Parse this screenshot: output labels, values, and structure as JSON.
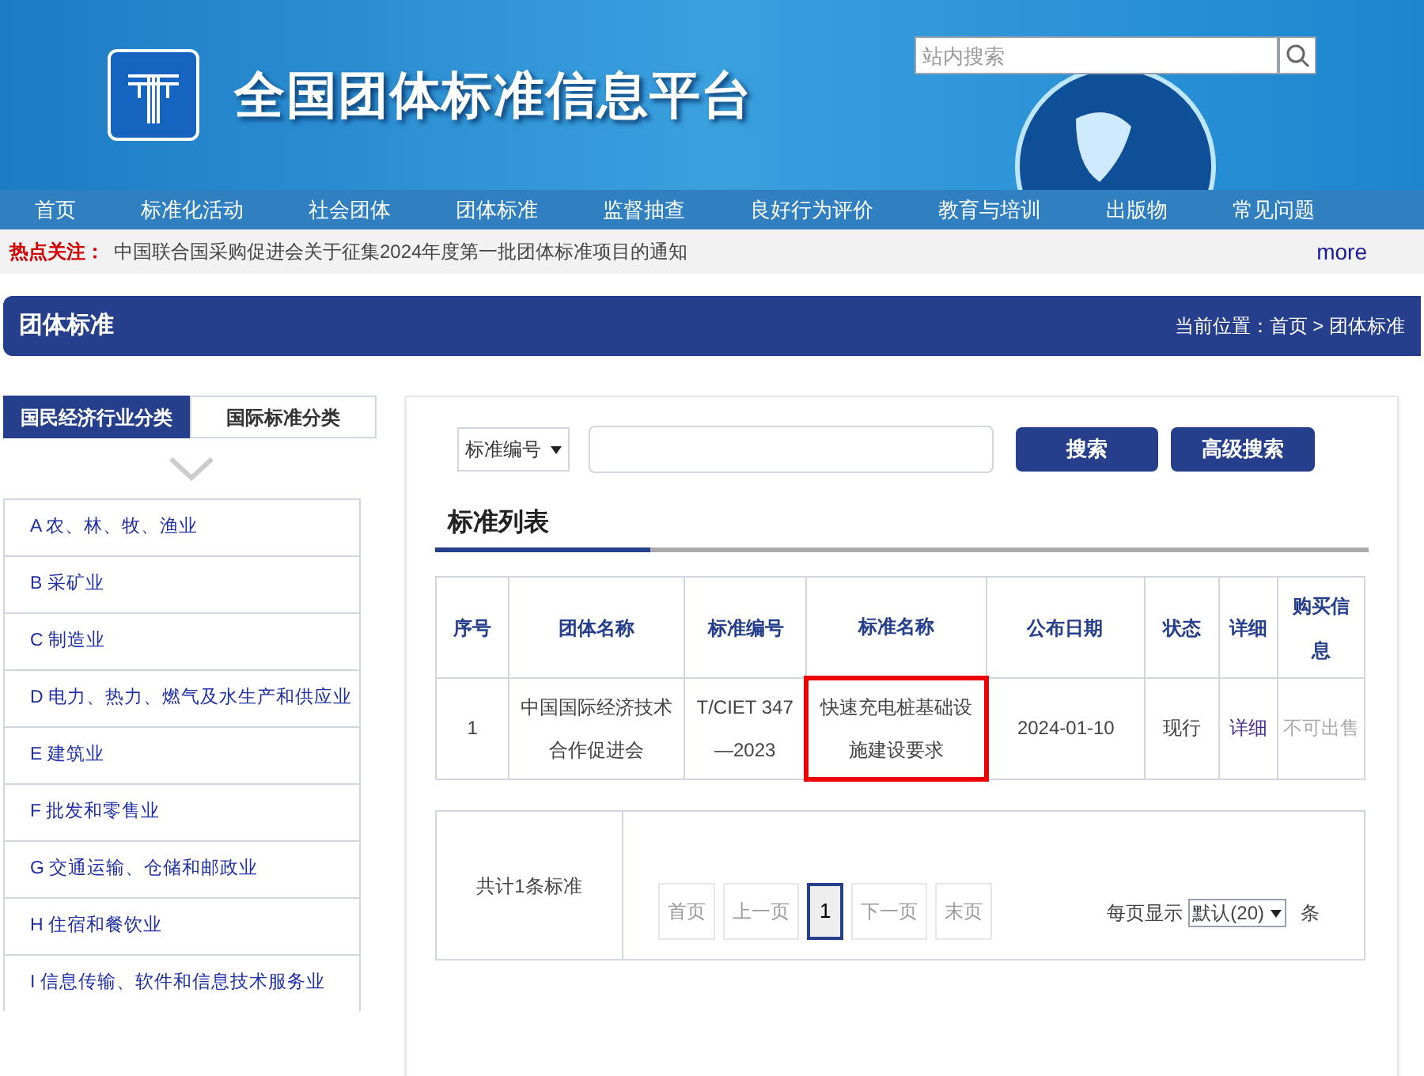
{
  "header": {
    "site_title": "全国团体标准信息平台",
    "search": {
      "placeholder": "站内搜索"
    }
  },
  "nav": [
    {
      "label": "首页"
    },
    {
      "label": "标准化活动"
    },
    {
      "label": "社会团体"
    },
    {
      "label": "团体标准"
    },
    {
      "label": "监督抽查"
    },
    {
      "label": "良好行为评价"
    },
    {
      "label": "教育与培训"
    },
    {
      "label": "出版物"
    },
    {
      "label": "常见问题"
    }
  ],
  "hot_news": {
    "label": "热点关注：",
    "text": "中国联合国采购促进会关于征集2024年度第一批团体标准项目的通知",
    "more": "more"
  },
  "page_title": {
    "title": "团体标准",
    "breadcrumb": "当前位置：首页 > 团体标准"
  },
  "sidebar": {
    "tabs": [
      {
        "label": "国民经济行业分类",
        "selected": true
      },
      {
        "label": "国际标准分类",
        "selected": false
      }
    ],
    "items": [
      {
        "label": "A 农、林、牧、渔业"
      },
      {
        "label": "B 采矿业"
      },
      {
        "label": "C 制造业"
      },
      {
        "label": "D 电力、热力、燃气及水生产和供应业"
      },
      {
        "label": "E 建筑业"
      },
      {
        "label": "F 批发和零售业"
      },
      {
        "label": "G 交通运输、仓储和邮政业"
      },
      {
        "label": "H 住宿和餐饮业"
      },
      {
        "label": "I 信息传输、软件和信息技术服务业"
      }
    ]
  },
  "search_bar": {
    "field_select": "标准编号",
    "buttons": [
      {
        "label": "搜索"
      },
      {
        "label": "高级搜索"
      }
    ]
  },
  "list_title": "标准列表",
  "table": {
    "columns": [
      "序号",
      "团体名称",
      "标准编号",
      "标准名称",
      "公布日期",
      "状态",
      "详细",
      "购买信息"
    ],
    "rows": [
      {
        "cells": [
          {
            "text": "1",
            "kind": "plain",
            "highlighted": false
          },
          {
            "text": "中国国际经济技术合作促进会",
            "kind": "plain",
            "highlighted": false
          },
          {
            "text": "T/CIET 347—2023",
            "kind": "plain",
            "highlighted": false
          },
          {
            "text": "快速充电桩基础设施建设要求",
            "kind": "plain",
            "highlighted": true
          },
          {
            "text": "2024-01-10",
            "kind": "plain",
            "highlighted": false
          },
          {
            "text": "现行",
            "kind": "plain",
            "highlighted": false
          },
          {
            "text": "详细",
            "kind": "link",
            "highlighted": false
          },
          {
            "text": "不可出售",
            "kind": "muted",
            "highlighted": false
          }
        ]
      }
    ]
  },
  "pagination": {
    "total": "共计1条标准",
    "pages": [
      {
        "label": "首页",
        "selected": false,
        "disabled": true
      },
      {
        "label": "上一页",
        "selected": false,
        "disabled": true
      },
      {
        "label": "1",
        "selected": true,
        "disabled": false
      },
      {
        "label": "下一页",
        "selected": false,
        "disabled": true
      },
      {
        "label": "末页",
        "selected": false,
        "disabled": true
      }
    ],
    "per_page_label": "每页显示",
    "per_page_value": "默认(20)",
    "per_page_unit": "条"
  }
}
